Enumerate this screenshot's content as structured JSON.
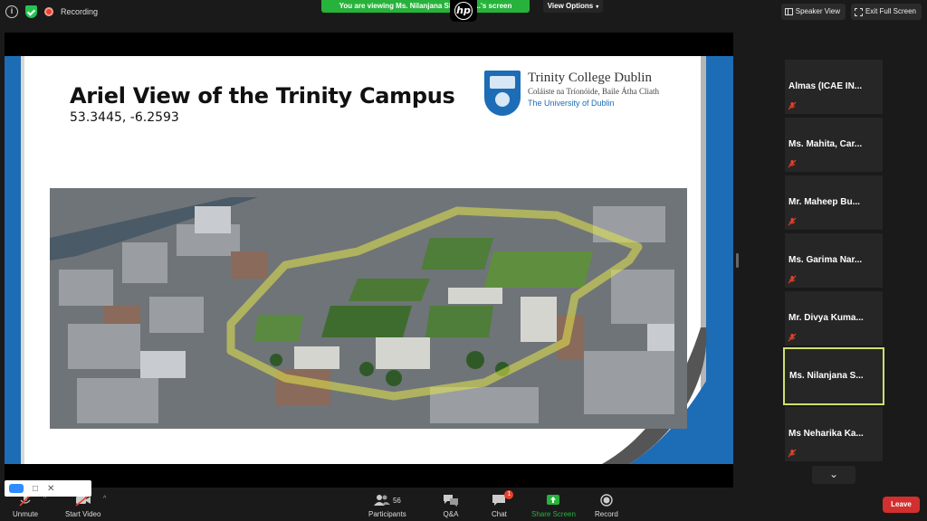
{
  "app": {
    "recording_label": "Recording",
    "viewing_banner": "You are viewing Ms. Nilanjana Shi... y C...'s screen",
    "hp_logo": "hp",
    "view_options": "View Options",
    "speaker_view": "Speaker View",
    "exit_full_screen": "Exit Full Screen"
  },
  "slide": {
    "title": "Ariel View of the Trinity Campus",
    "coordinates": "53.3445, -6.2593",
    "logo": {
      "name": "Trinity College Dublin",
      "irish": "Coláiste na Tríonóide, Baile Átha Cliath",
      "university": "The University of Dublin"
    }
  },
  "participants": [
    {
      "name": "Almas   (ICAE IN...",
      "muted": true,
      "active": false
    },
    {
      "name": "Ms.  Mahita,  Car...",
      "muted": true,
      "active": false
    },
    {
      "name": "Mr.  Maheep  Bu...",
      "muted": true,
      "active": false
    },
    {
      "name": "Ms.  Garima  Nar...",
      "muted": true,
      "active": false
    },
    {
      "name": "Mr.  Divya  Kuma...",
      "muted": true,
      "active": false
    },
    {
      "name": "Ms.  Nilanjana  S...",
      "muted": false,
      "active": true
    },
    {
      "name": "Ms  Neharika  Ka...",
      "muted": true,
      "active": false
    }
  ],
  "toolbar": {
    "unmute": "Unmute",
    "start_video": "Start Video",
    "participants": "Participants",
    "participants_count": "56",
    "qa": "Q&A",
    "chat": "Chat",
    "chat_badge": "1",
    "share_screen": "Share Screen",
    "record": "Record",
    "leave": "Leave"
  },
  "colors": {
    "background": "#1a1a1a",
    "banner_green": "#27b33b",
    "leave_red": "#d32f2f",
    "slide_blue": "#1d6cb6",
    "active_border": "#cfe06b"
  }
}
